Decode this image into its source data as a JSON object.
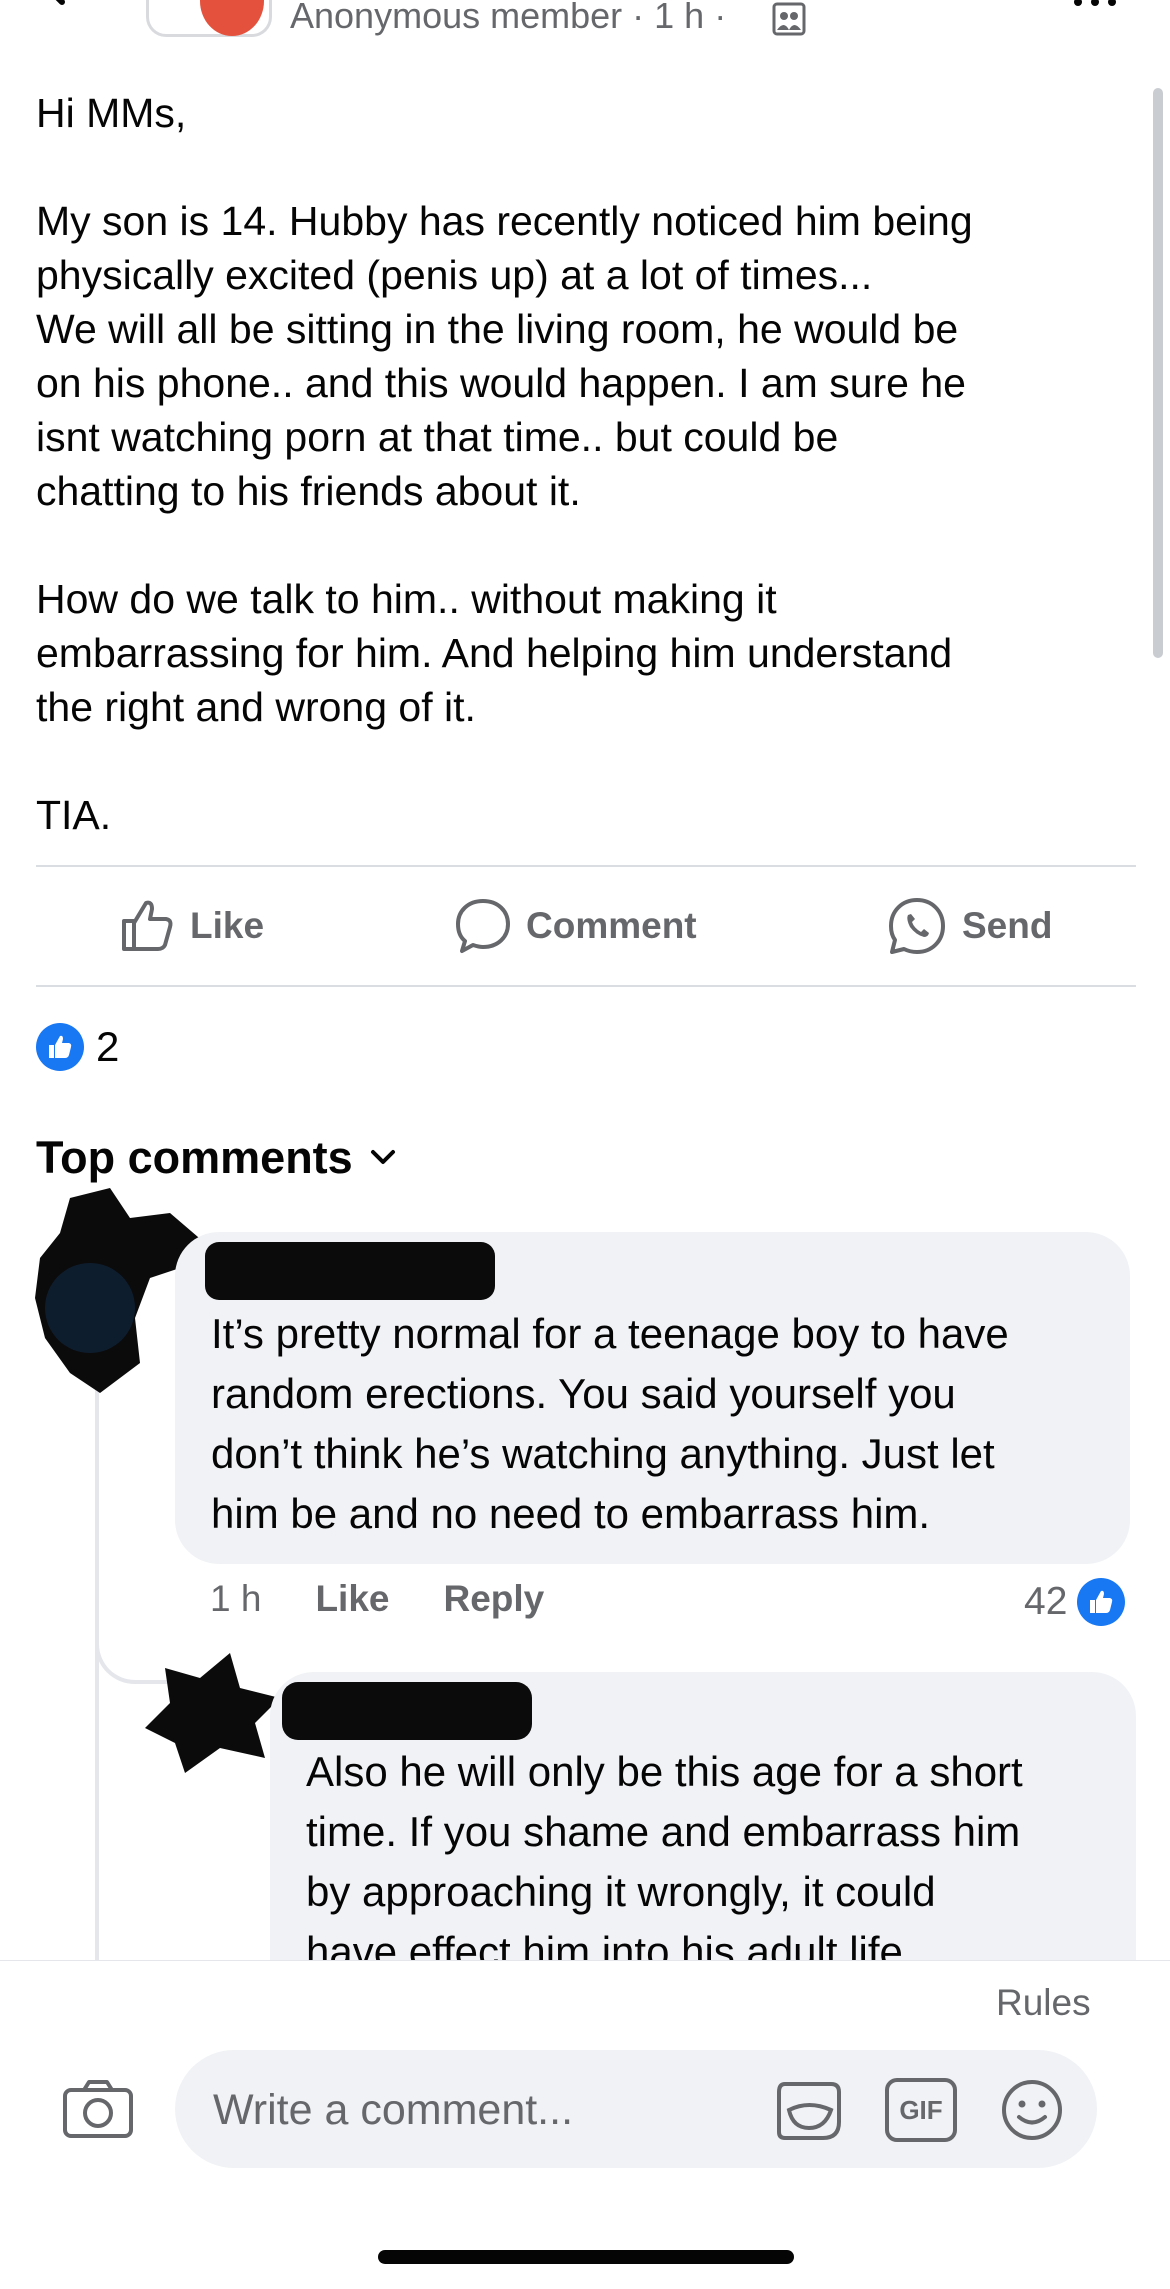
{
  "header": {
    "author": "Anonymous member",
    "time": "1 h"
  },
  "post": {
    "paragraphs": [
      "Hi MMs,",
      "My son is 14. Hubby has recently noticed him being\nphysically excited (penis up) at a lot of times...\nWe will all be sitting in the living room, he would be\non his phone.. and this would happen. I am sure he\nisnt watching porn at that time.. but could be\nchatting to his friends about it.",
      "How do we talk to him.. without making it\nembarrassing for him. And helping him understand\nthe right and wrong of it.",
      "TIA."
    ]
  },
  "actions": {
    "like": "Like",
    "comment": "Comment",
    "send": "Send"
  },
  "reactions": {
    "count": "2"
  },
  "comments_section": {
    "title": "Top comments"
  },
  "comments": [
    {
      "text": "It’s pretty normal for a teenage boy to have\nrandom erections. You said yourself you\ndon’t think he’s watching anything. Just let\nhim be and no need to embarrass him.",
      "time": "1 h",
      "like_label": "Like",
      "reply_label": "Reply",
      "likes": "42"
    },
    {
      "text": "Also he will only be this age for a short\ntime. If you shame and embarrass him\nby approaching it wrongly, it could\nhave effect him into his adult life"
    }
  ],
  "composer": {
    "rules": "Rules",
    "placeholder": "Write a comment...",
    "gif_label": "GIF"
  },
  "colors": {
    "accent": "#1877f2",
    "secondary_text": "#65676b",
    "bubble": "#f0f2f5"
  }
}
